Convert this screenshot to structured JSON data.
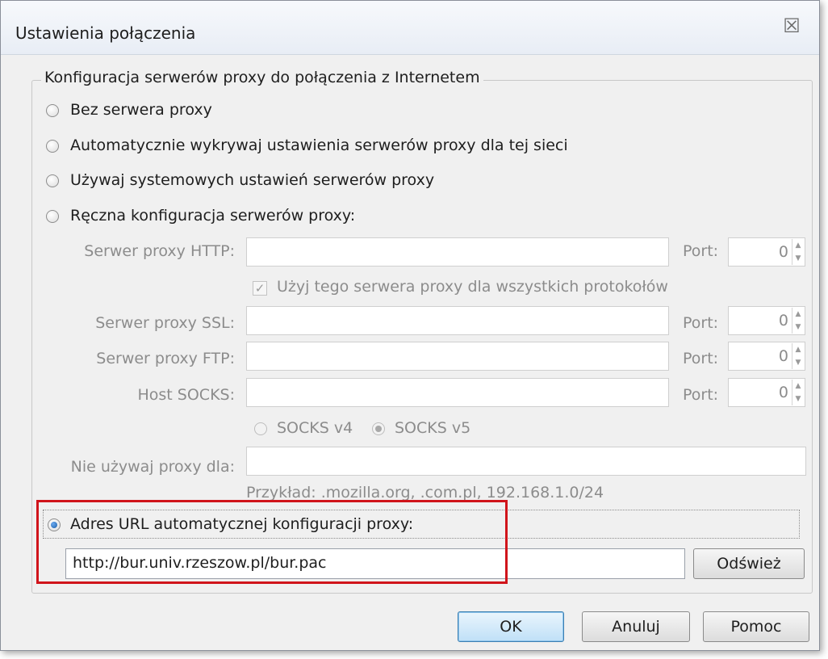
{
  "window": {
    "title": "Ustawienia połączenia",
    "close_glyph": "☒"
  },
  "group": {
    "legend": "Konfiguracja serwerów proxy do połączenia z Internetem"
  },
  "options": [
    {
      "label": "Bez serwera proxy",
      "checked": false
    },
    {
      "label": "Automatycznie wykrywaj ustawienia serwerów proxy dla tej sieci",
      "checked": false
    },
    {
      "label": "Używaj systemowych ustawień serwerów proxy",
      "checked": false
    },
    {
      "label": "Ręczna konfiguracja serwerów proxy:",
      "checked": false
    }
  ],
  "manual": {
    "http_label": "Serwer proxy HTTP:",
    "http_value": "",
    "http_port_label": "Port:",
    "http_port": "0",
    "use_for_all": "Użyj tego serwera proxy dla wszystkich protokołów",
    "use_for_all_checked": true,
    "ssl_label": "Serwer proxy SSL:",
    "ssl_value": "",
    "ssl_port_label": "Port:",
    "ssl_port": "0",
    "ftp_label": "Serwer proxy FTP:",
    "ftp_value": "",
    "ftp_port_label": "Port:",
    "ftp_port": "0",
    "socks_label": "Host SOCKS:",
    "socks_value": "",
    "socks_port_label": "Port:",
    "socks_port": "0",
    "socks_v4": "SOCKS v4",
    "socks_v5": "SOCKS v5",
    "no_proxy_label": "Nie używaj proxy dla:",
    "no_proxy_value": "",
    "example": "Przykład: .mozilla.org, .com.pl, 192.168.1.0/24"
  },
  "autoconfig": {
    "label": "Adres URL automatycznej konfiguracji proxy:",
    "checked": true,
    "url": "http://bur.univ.rzeszow.pl/bur.pac",
    "reload_label": "Odśwież"
  },
  "buttons": {
    "ok": "OK",
    "cancel": "Anuluj",
    "help": "Pomoc"
  },
  "colors": {
    "highlight": "#d0141b",
    "window_bg": "#f0f0f0",
    "default_button": "#bfe0f7"
  }
}
